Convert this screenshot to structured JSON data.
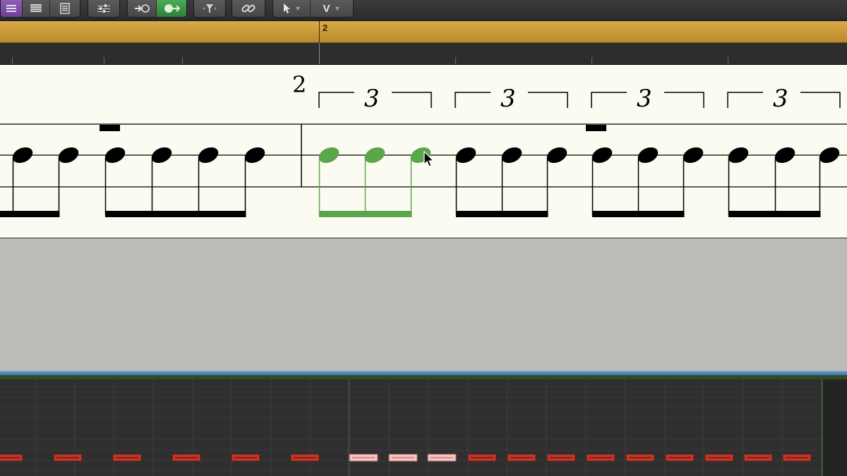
{
  "toolbar": {
    "groups": [
      {
        "name": "view-group",
        "buttons": [
          {
            "name": "list-view-button",
            "icon": "lines-icon",
            "active": true
          },
          {
            "name": "stack-view-button",
            "icon": "stack-icon"
          },
          {
            "name": "page-view-button",
            "icon": "page-icon"
          }
        ]
      },
      {
        "name": "mixer-group",
        "buttons": [
          {
            "name": "controls-button",
            "icon": "sliders-icon"
          }
        ]
      },
      {
        "name": "midi-group",
        "buttons": [
          {
            "name": "midi-in-button",
            "icon": "midi-in-icon"
          },
          {
            "name": "midi-out-button",
            "icon": "midi-out-icon",
            "active": true
          }
        ]
      },
      {
        "name": "filter-group",
        "buttons": [
          {
            "name": "filter-button",
            "icon": "filter-icon"
          }
        ]
      },
      {
        "name": "link-group",
        "buttons": [
          {
            "name": "link-button",
            "icon": "link-icon"
          }
        ]
      },
      {
        "name": "tool-group",
        "buttons": [
          {
            "name": "pointer-tool-button",
            "icon": "pointer-icon"
          },
          {
            "name": "secondary-tool-button",
            "label": "V"
          }
        ]
      }
    ]
  },
  "region": {
    "bar_number": "2",
    "color": "#c99a36"
  },
  "score": {
    "time_signature": "2",
    "tuplets": [
      "3",
      "3",
      "3",
      "3"
    ],
    "note_color": "#000000",
    "selected_color": "#5aa64a"
  },
  "piano_roll": {
    "note_color": "#c0392b",
    "selected_note_color": "#f3c6c2"
  }
}
